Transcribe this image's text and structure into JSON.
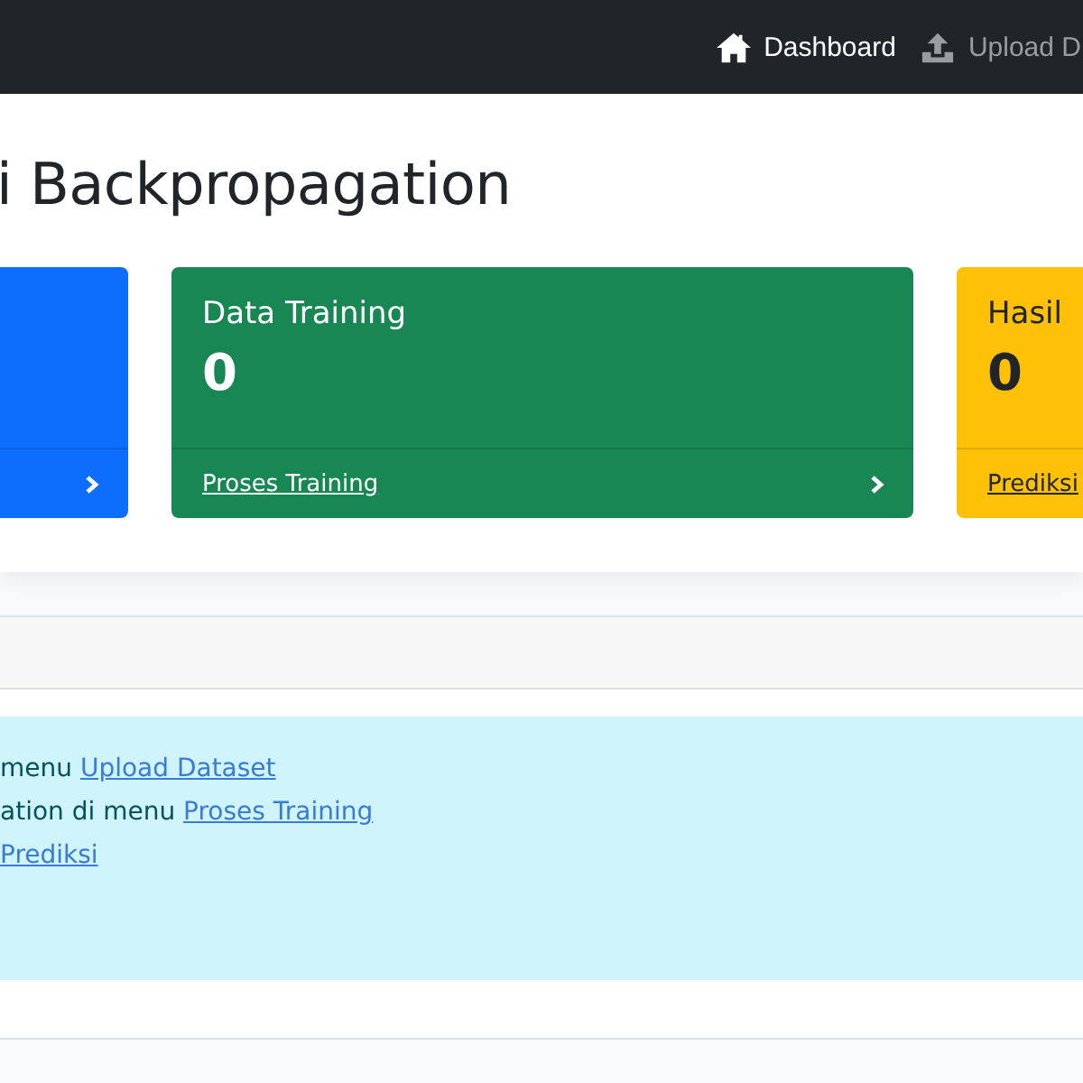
{
  "navbar": {
    "items": [
      {
        "label": "Dashboard",
        "kind": "home",
        "selected": true
      },
      {
        "label": "Upload D",
        "kind": "upload",
        "selected": false
      }
    ]
  },
  "page_title": "i Backpropagation",
  "cards": [
    {
      "color": "#0d6efd",
      "dark_text": false
    },
    {
      "color": "#198754",
      "title": "Data Training",
      "value": "0",
      "link": "Proses Training",
      "dark_text": false
    },
    {
      "color": "#ffc107",
      "title": "Hasil",
      "value": "0",
      "link": "Prediksi",
      "dark_text": true
    }
  ],
  "info_lines": [
    {
      "text": "menu ",
      "link": "Upload Dataset"
    },
    {
      "text": "ation di menu ",
      "link": "Proses Training"
    },
    {
      "link": "Prediksi"
    }
  ]
}
